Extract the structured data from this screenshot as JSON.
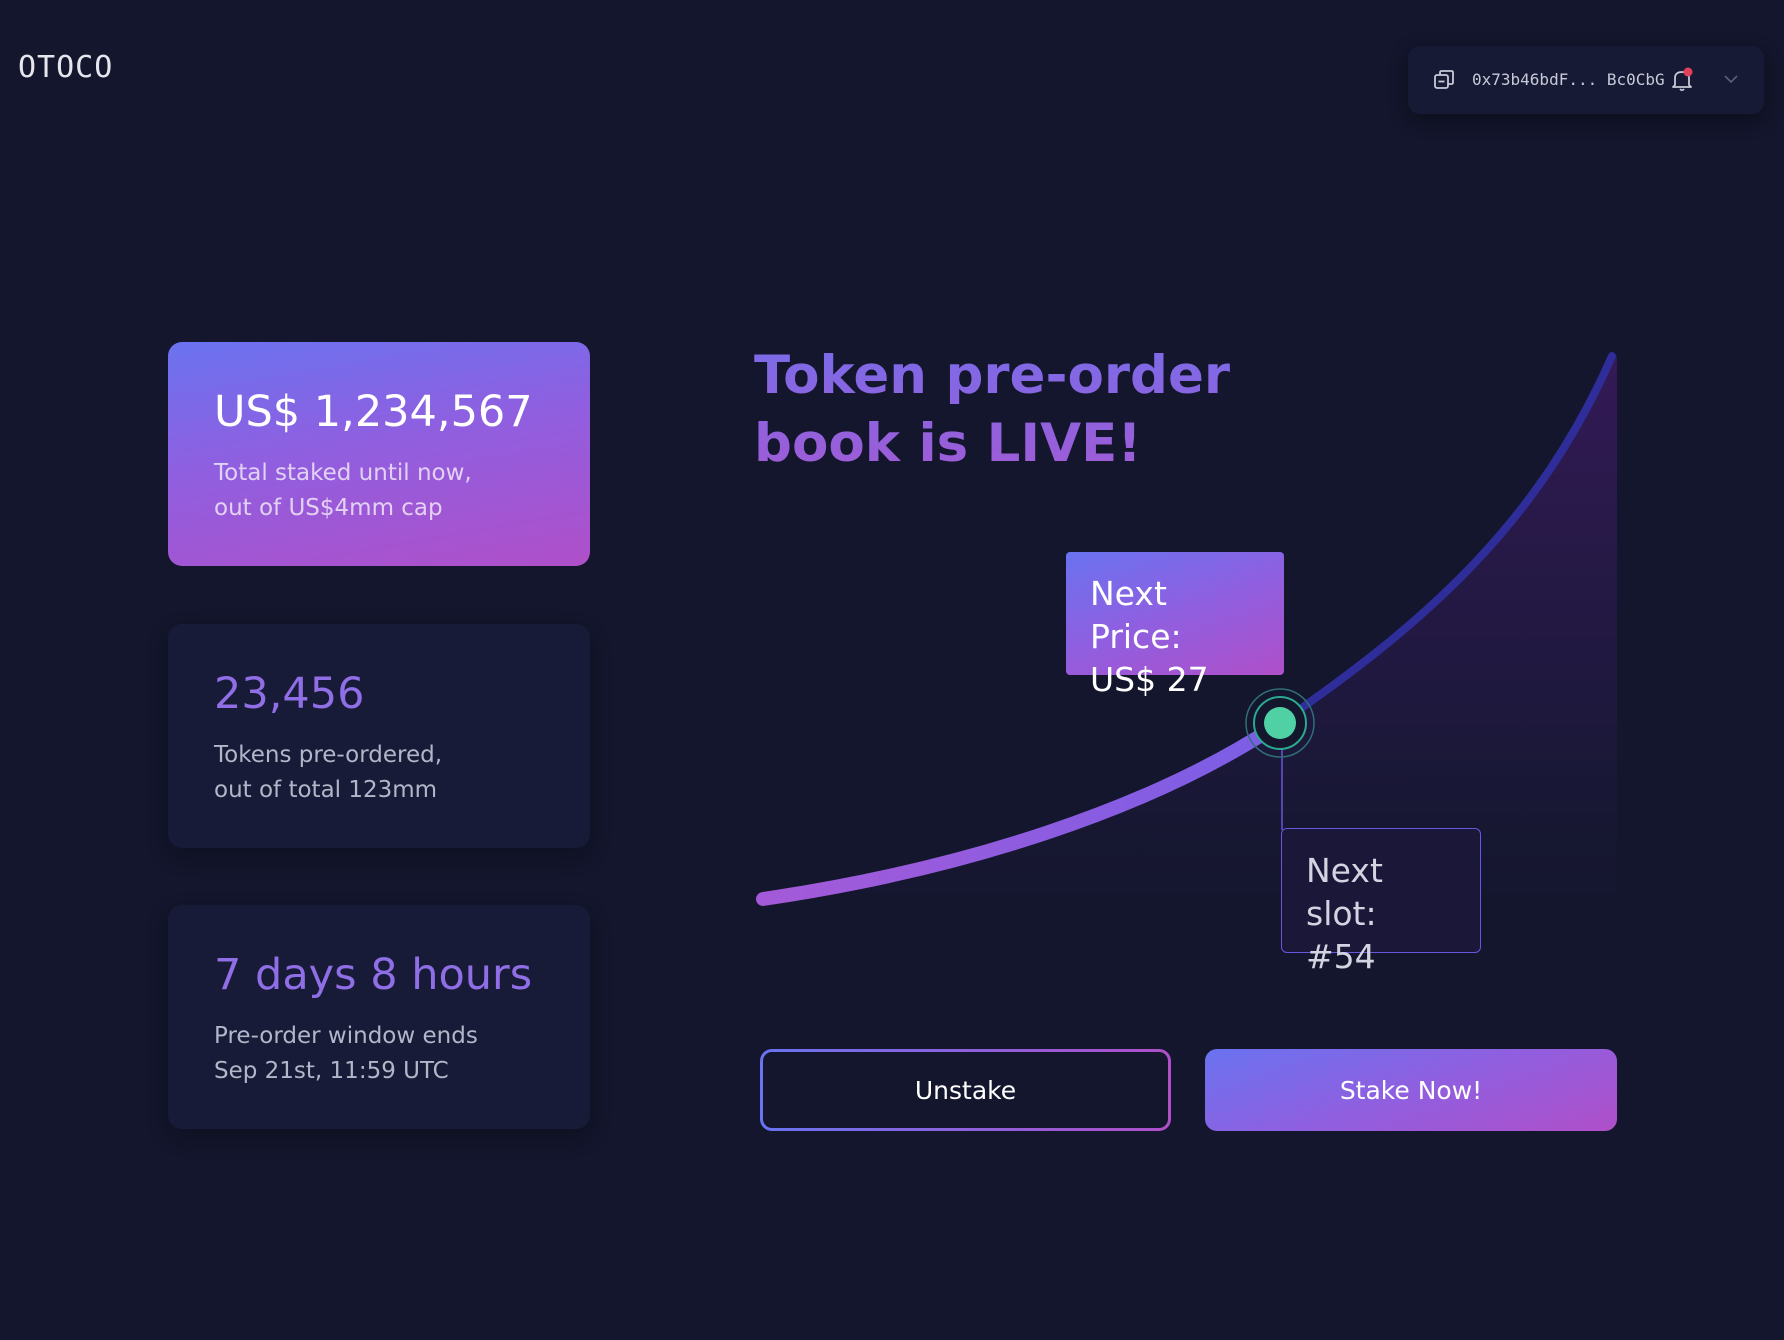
{
  "brand": {
    "logo_text": "OTOCO"
  },
  "header": {
    "wallet_address": "0x73b46bdF... Bc0CbG",
    "icons": [
      "copy-icon",
      "bell-icon",
      "chevron-down-icon"
    ],
    "notification_dot_color": "#e0405a"
  },
  "stats": [
    {
      "value": "US$ 1,234,567",
      "desc_line1": "Total staked until now,",
      "desc_line2": "out of US$4mm cap"
    },
    {
      "value": "23,456",
      "desc_line1": "Tokens pre-ordered,",
      "desc_line2": "out of total 123mm"
    },
    {
      "value": "7 days 8 hours",
      "desc_line1": "Pre-order window ends",
      "desc_line2": "Sep 21st, 11:59 UTC"
    }
  ],
  "main": {
    "headline_line1": "Token pre-order",
    "headline_line2": "book is LIVE!",
    "next_price_label": "Next Price:",
    "next_price_value": "US$ 27",
    "next_slot_label": "Next slot:",
    "next_slot_value": "#54",
    "current_position_fraction": 0.6,
    "marker_color": "#4fd1a5"
  },
  "actions": {
    "unstake_label": "Unstake",
    "stake_label": "Stake Now!"
  },
  "colors": {
    "background": "#13162c",
    "gradient_start": "#6a73f0",
    "gradient_end": "#b04fc9",
    "accent_text": "#8f6ee6"
  }
}
